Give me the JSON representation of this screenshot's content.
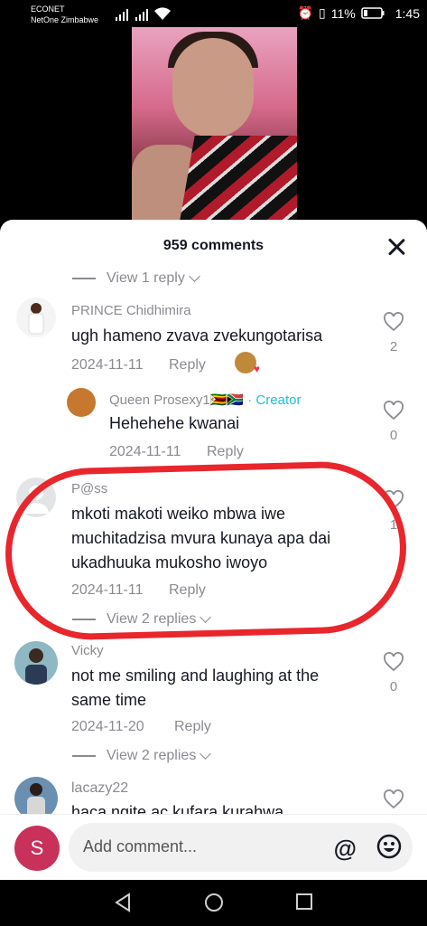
{
  "status_bar": {
    "carrier_1": "ECONET",
    "carrier_2": "NetOne Zimbabwe",
    "battery": "11%",
    "time": "1:45"
  },
  "sheet": {
    "title": "959 comments",
    "top_view_reply": "View 1 reply"
  },
  "comments": [
    {
      "name": "PRINCE Chidhimira",
      "text": "ugh hameno zvava zvekungotarisa",
      "date": "2024-11-11",
      "reply": "Reply",
      "likes": "2"
    },
    {
      "name": "Queen Prosexy1🇿🇼🇿🇦",
      "creator": "· Creator",
      "text": "Hehehehe kwanai",
      "date": "2024-11-11",
      "reply": "Reply",
      "likes": "0"
    },
    {
      "name": "P@ss",
      "text_lines": [
        "mkoti makoti weiko mbwa iwe",
        "muchitadzisa mvura kunaya apa dai",
        "ukadhuuka mukosho iwoyo"
      ],
      "date": "2024-11-11",
      "reply": "Reply",
      "likes": "1",
      "view_replies": "View 2 replies"
    },
    {
      "name": "Vicky",
      "text_lines": [
        "not me smiling and laughing at the",
        "same time"
      ],
      "date": "2024-11-20",
      "reply": "Reply",
      "likes": "0",
      "view_replies": "View 2 replies"
    },
    {
      "name": "lacazy22",
      "text": "haca ngite ac kufara kurahwa"
    }
  ],
  "composer": {
    "avatar_letter": "S",
    "placeholder": "Add comment..."
  }
}
